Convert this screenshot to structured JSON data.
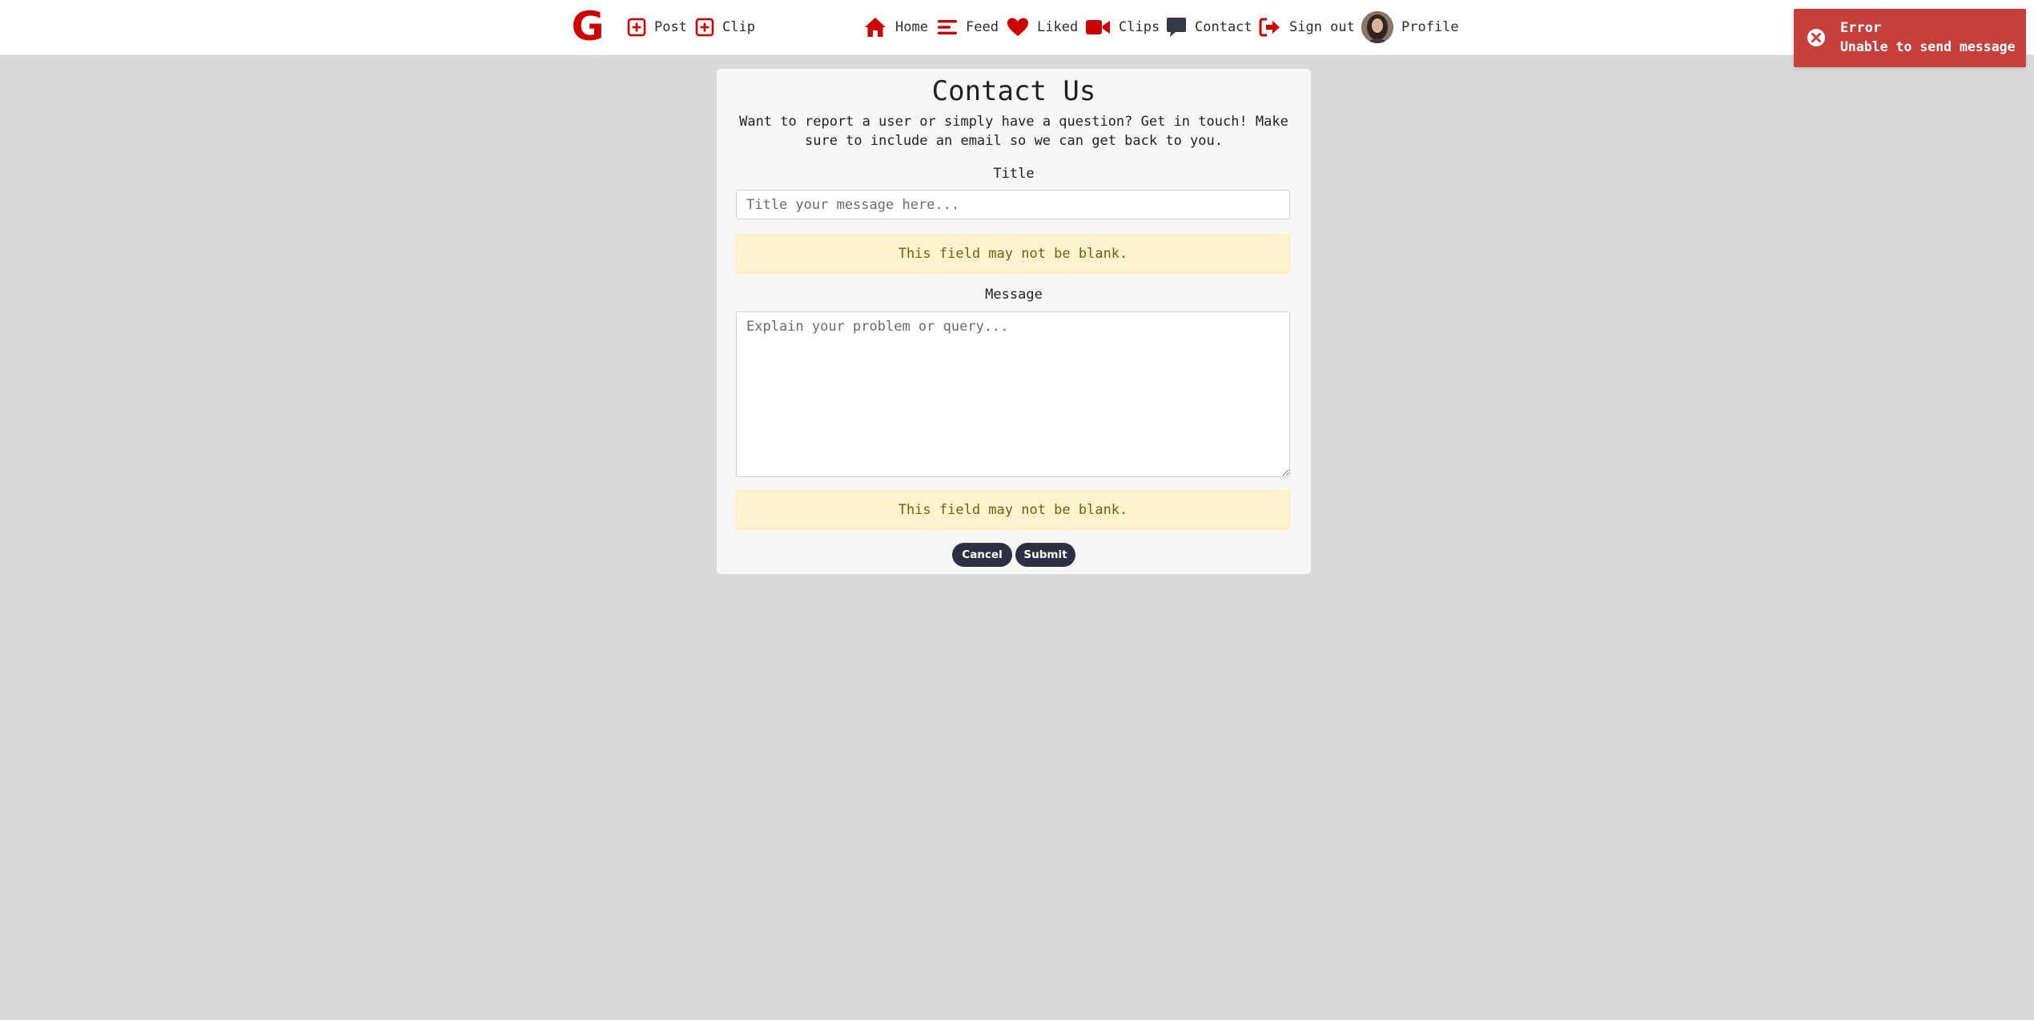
{
  "nav": {
    "post_label": "Post",
    "clip_label": "Clip",
    "home_label": "Home",
    "feed_label": "Feed",
    "liked_label": "Liked",
    "clips_label": "Clips",
    "contact_label": "Contact",
    "signout_label": "Sign out",
    "profile_label": "Profile",
    "logo_text": "G"
  },
  "toast": {
    "title": "Error",
    "message": "Unable to send message"
  },
  "contact": {
    "heading": "Contact Us",
    "description": "Want to report a user or simply have a question? Get in touch! Make sure to include an email so we can get back to you.",
    "title_label": "Title",
    "title_placeholder": "Title your message here...",
    "title_value": "",
    "title_error": "This field may not be blank.",
    "message_label": "Message",
    "message_placeholder": "Explain your problem or query...",
    "message_value": "",
    "message_error": "This field may not be blank.",
    "cancel_label": "Cancel",
    "submit_label": "Submit"
  },
  "colors": {
    "brand_red": "#cc0000",
    "background": "#dadada",
    "card": "#f7f7f7",
    "button": "#2b3140",
    "toast": "#c5403a",
    "alert_bg": "#fff3cd",
    "alert_text": "#7a5b12"
  },
  "icons": {
    "post": "plus-square-icon",
    "clip": "plus-square-icon",
    "home": "house-icon",
    "feed": "bars-icon",
    "liked": "heart-icon",
    "clips": "video-camera-icon",
    "contact": "speech-bubble-icon",
    "signout": "sign-out-icon",
    "toast": "x-circle-icon"
  }
}
